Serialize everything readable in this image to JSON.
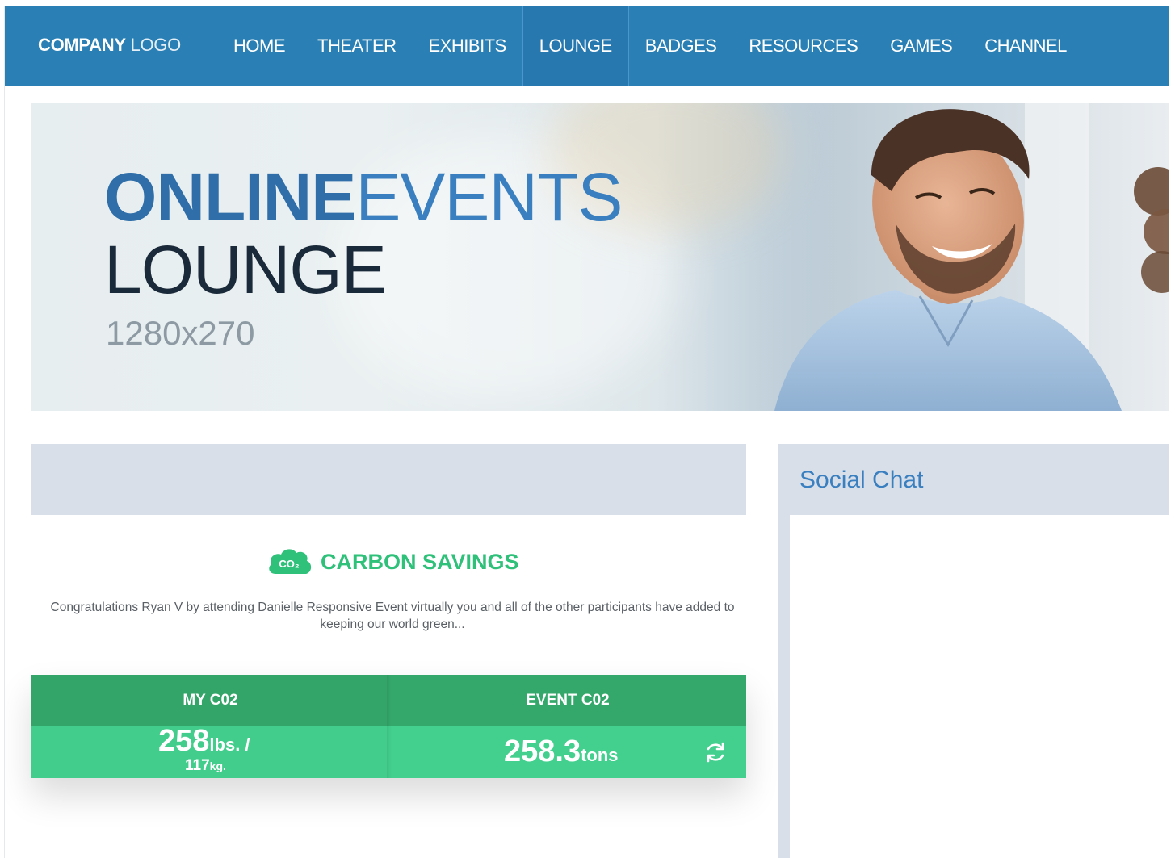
{
  "nav": {
    "logo_bold": "COMPANY",
    "logo_light": "LOGO",
    "items": [
      {
        "label": "HOME"
      },
      {
        "label": "THEATER"
      },
      {
        "label": "EXHIBITS"
      },
      {
        "label": "LOUNGE",
        "active": true
      },
      {
        "label": "BADGES"
      },
      {
        "label": "RESOURCES"
      },
      {
        "label": "GAMES"
      },
      {
        "label": "CHANNEL"
      }
    ]
  },
  "hero": {
    "title_bold": "ONLINE",
    "title_thin": "EVENTS",
    "subtitle": "LOUNGE",
    "dimensions": "1280x270"
  },
  "carbon": {
    "badge_text": "CO₂",
    "title": "CARBON SAVINGS",
    "message": "Congratulations Ryan V by attending Danielle Responsive Event virtually you and all of the other participants have added to keeping our world green...",
    "my": {
      "label": "MY C02",
      "value": "258",
      "unit": "lbs. /",
      "kg_value": "117",
      "kg_unit": "kg."
    },
    "event": {
      "label": "EVENT C02",
      "value": "258.3",
      "unit": "tons"
    }
  },
  "chat": {
    "title": "Social Chat"
  },
  "colors": {
    "nav": "#2a80b5",
    "green_dark": "#34a86a",
    "green_light": "#43cf8d",
    "panel": "#d8dfe8"
  }
}
